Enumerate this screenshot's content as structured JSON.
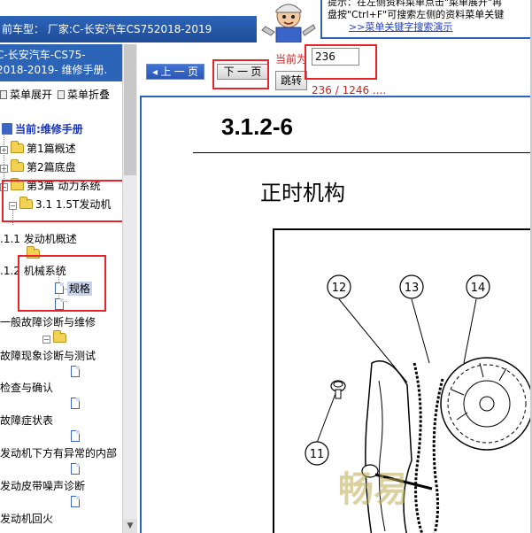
{
  "header": {
    "vehicle_label": "前车型：  厂家:C-长安汽车CS752018-2019",
    "hint_line1": "提示：在左侧资料菜单点击\"菜单展开\"再",
    "hint_line2": "盘按\"Ctrl+F\"可搜索左侧的资料菜单关键",
    "hint_link": ">>菜单关键字搜索演示"
  },
  "sidebar": {
    "title_line1": "C-长安汽车-CS75-",
    "title_line2": "2018-2019- 维修手册.",
    "expand_label": "菜单展开",
    "collapse_label": "菜单折叠",
    "tree": {
      "current": "当前:维修手册",
      "ch1": "第1篇概述",
      "ch2": "第2篇底盘",
      "ch3": "第3篇 动力系统",
      "sec31": "3.1 1.5T发动机",
      "sec311": ".1.1 发动机概述",
      "sec312": ".1.2 机械系统",
      "leaf_spec": "规格",
      "n_diag": "一般故障诊断与维修",
      "n_symptom_test": "故障现象诊断与测试",
      "n_check": "检查与确认",
      "n_symptom_table": "故障症状表",
      "n_noise_inside": "发动机下方有异常的内部",
      "n_belt_noise": "发动皮带噪声诊断",
      "n_backfire": "发动机回火"
    }
  },
  "toolbar": {
    "prev_label": "上 一 页",
    "next_label": "下 一 页",
    "current_label": "当前为",
    "page_value": "236",
    "jump_label": "跳转",
    "page_count": "236 / 1246 ...."
  },
  "document": {
    "section_number": "3.1.2-6",
    "section_title": "正时机构",
    "callouts": [
      "12",
      "13",
      "14",
      "11"
    ],
    "watermark": "畅易"
  }
}
